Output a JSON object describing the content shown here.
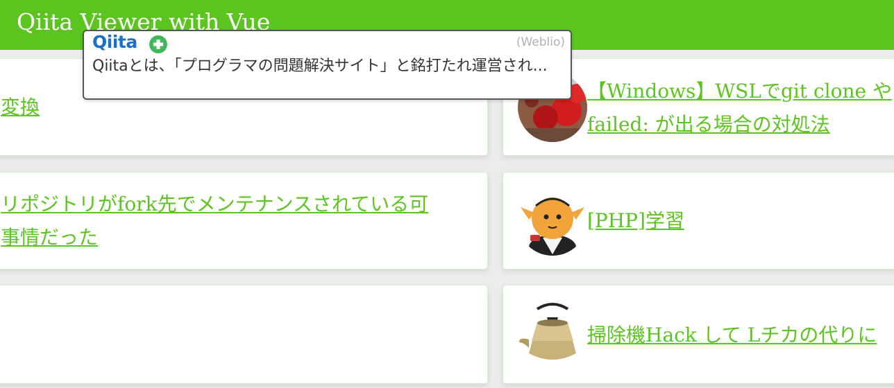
{
  "header": {
    "title": "Qiita Viewer with Vue"
  },
  "popup": {
    "logo": "Qiita",
    "source": "(Weblio)",
    "text": "Qiitaとは、「プログラマの問題解決サイト」と銘打たれ運営され..."
  },
  "articles_left": [
    {
      "title_lines": [
        "変換"
      ]
    },
    {
      "title_lines": [
        "リポジトリがfork先でメンテナンスされている可",
        "事情だった"
      ]
    },
    {
      "title_lines": []
    }
  ],
  "articles_right": [
    {
      "avatar": "red-leaves-avatar",
      "title_lines": [
        "【Windows】WSLでgit clone や",
        "failed: が出る場合の対処法"
      ]
    },
    {
      "avatar": "cartoon-character-avatar",
      "title_lines": [
        "[PHP]学習"
      ]
    },
    {
      "avatar": "teapot-avatar",
      "title_lines": [
        "掃除機Hack して Lチカの代りに"
      ]
    }
  ],
  "colors": {
    "accent": "#5bc41f",
    "qiita_logo": "#1a6fc9",
    "background": "#ececec"
  }
}
